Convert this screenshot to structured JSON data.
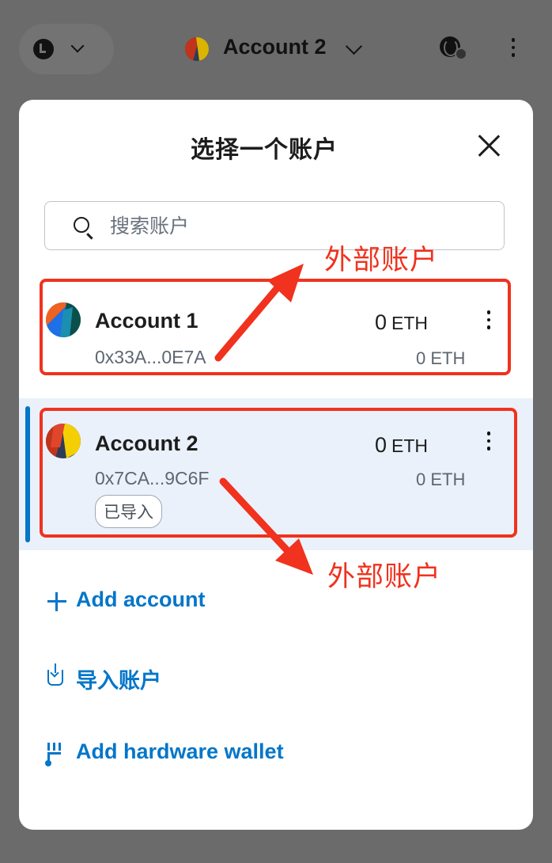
{
  "header": {
    "network_icon": "network-logo-icon",
    "account_name": "Account 2"
  },
  "modal": {
    "title": "选择一个账户",
    "search": {
      "placeholder": "搜索账户",
      "value": ""
    },
    "accounts": [
      {
        "name": "Account 1",
        "address": "0x33A...0E7A",
        "balance_value": "0",
        "balance_unit": "ETH",
        "fiat_balance": "0 ETH",
        "selected": false,
        "badge": ""
      },
      {
        "name": "Account 2",
        "address": "0x7CA...9C6F",
        "balance_value": "0",
        "balance_unit": "ETH",
        "fiat_balance": "0 ETH",
        "selected": true,
        "badge": "已导入"
      }
    ],
    "actions": {
      "add_account": "+ Add account",
      "import_account": "导入账户",
      "add_hardware": "Add hardware wallet"
    }
  },
  "annotations": {
    "label_1": "外部账户",
    "label_2": "外部账户"
  },
  "colors": {
    "accent": "#0376c9",
    "annotation_red": "#f0321e",
    "selected_row_bg": "#eaf1fb",
    "overlay": "#6b6b6b"
  }
}
